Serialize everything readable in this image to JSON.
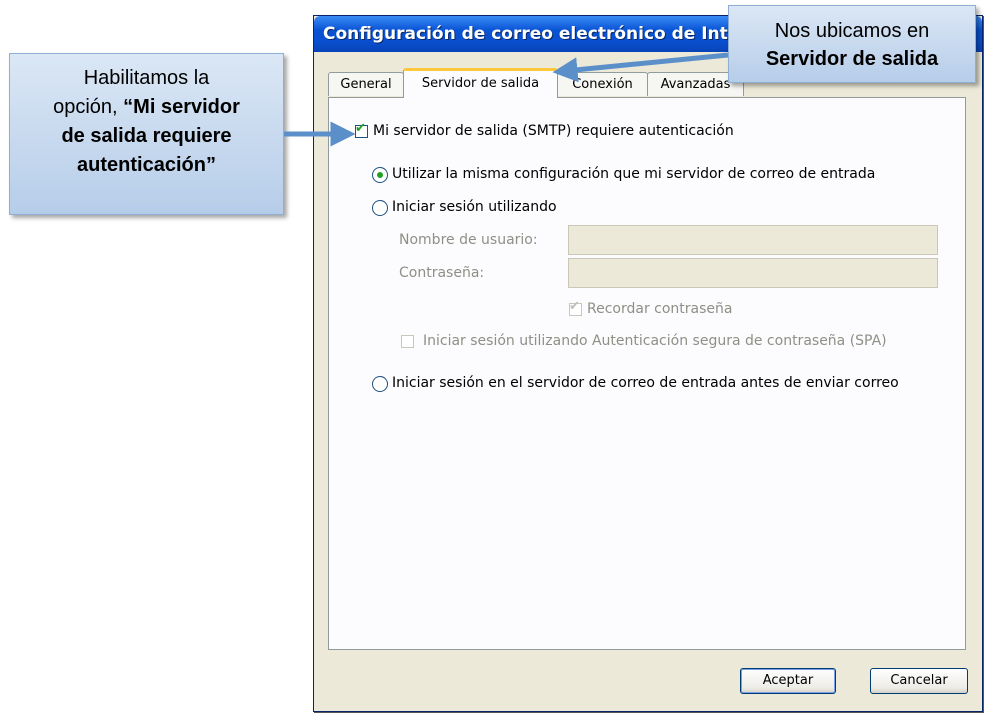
{
  "dialog": {
    "title": "Configuración de correo electrónico de Int",
    "tabs": [
      "General",
      "Servidor de salida",
      "Conexión",
      "Avanzadas"
    ],
    "active_tab": "Servidor de salida",
    "smtp_auth_label": "Mi servidor de salida (SMTP) requiere autenticación",
    "smtp_auth_checked": true,
    "radio_same_label": "Utilizar la misma configuración que mi servidor de correo de entrada",
    "radio_login_label": "Iniciar sesión utilizando",
    "username_label": "Nombre de usuario:",
    "username_value": "",
    "password_label": "Contraseña:",
    "password_value": "",
    "remember_label": "Recordar contraseña",
    "spa_label": "Iniciar sesión utilizando Autenticación segura de contraseña (SPA)",
    "radio_pop_label": "Iniciar sesión en el servidor de correo de entrada antes de enviar correo",
    "ok_label": "Aceptar",
    "cancel_label": "Cancelar"
  },
  "callouts": {
    "left": {
      "line1": "Habilitamos la",
      "line2_prefix": "opción, ",
      "line2_bold": "“Mi servidor",
      "line3": "de salida requiere",
      "line4": "autenticación”"
    },
    "top": {
      "line1": "Nos ubicamos en",
      "line2": "Servidor de salida"
    }
  },
  "colors": {
    "titlebar": "#0a4fcf",
    "dialog_bg": "#ece9d8",
    "callout_fill": "#c9dbf0",
    "arrow": "#5b8fc9",
    "check_green": "#21a121"
  }
}
